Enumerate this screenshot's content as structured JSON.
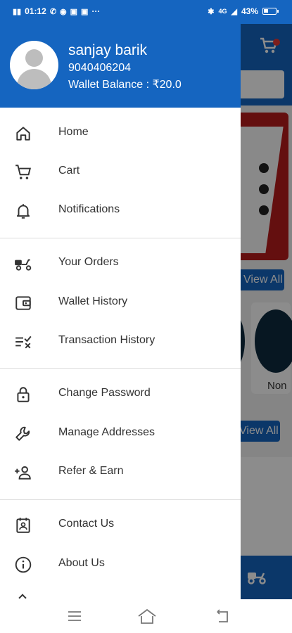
{
  "status_bar": {
    "time": "01:12",
    "battery": "43%",
    "battery_level": 0.43,
    "network": "4G",
    "more": "···"
  },
  "drawer": {
    "user": {
      "name": "sanjay barik",
      "phone": "9040406204",
      "wallet_label": "Wallet Balance : ₹20.0"
    },
    "items": [
      {
        "label": "Home",
        "icon": "home-icon"
      },
      {
        "label": "Cart",
        "icon": "cart-icon"
      },
      {
        "label": "Notifications",
        "icon": "bell-icon"
      },
      {
        "label": "Your Orders",
        "icon": "scooter-icon"
      },
      {
        "label": "Wallet History",
        "icon": "wallet-icon"
      },
      {
        "label": "Transaction History",
        "icon": "transaction-list-icon"
      },
      {
        "label": "Change Password",
        "icon": "lock-icon"
      },
      {
        "label": "Manage Addresses",
        "icon": "wrench-icon"
      },
      {
        "label": "Refer & Earn",
        "icon": "add-person-icon"
      },
      {
        "label": "Contact Us",
        "icon": "contact-card-icon"
      },
      {
        "label": "About Us",
        "icon": "info-icon"
      }
    ]
  },
  "background": {
    "view_all_1": "View All",
    "view_all_2": "View All",
    "category_label": "Non"
  },
  "colors": {
    "primary": "#1565c0",
    "drawer_bg": "#ffffff",
    "text": "#333333"
  }
}
